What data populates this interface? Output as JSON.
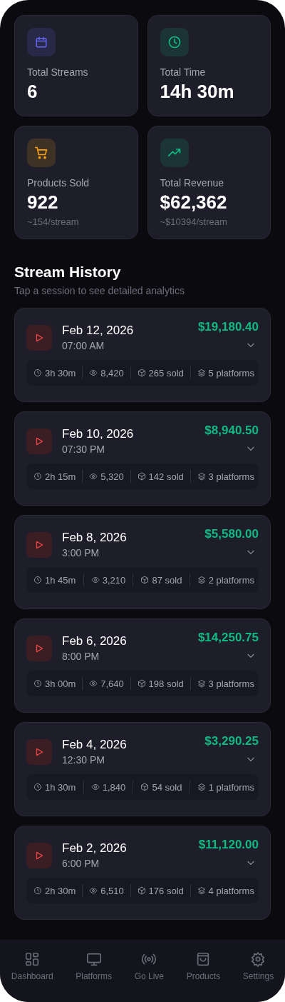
{
  "stats": [
    {
      "kind": "calendar",
      "color": "#6366f1",
      "label": "Total Streams",
      "value": "6"
    },
    {
      "kind": "clock",
      "color": "#10b981",
      "label": "Total Time",
      "value": "14h 30m"
    },
    {
      "kind": "cart",
      "color": "#f59e0b",
      "label": "Products Sold",
      "value": "922",
      "sub": "~154/stream"
    },
    {
      "kind": "trend",
      "color": "#10b981",
      "label": "Total Revenue",
      "value": "$62,362",
      "sub": "~$10394/stream"
    }
  ],
  "history": {
    "title": "Stream History",
    "subtitle": "Tap a session to see detailed analytics",
    "sessions": [
      {
        "date": "Feb 12, 2026",
        "time": "07:00 AM",
        "revenue": "$19,180.40",
        "expanded": false,
        "duration": "3h 30m",
        "views": "8,420",
        "sold": "265 sold",
        "platforms": "5 platforms"
      },
      {
        "date": "Feb 10, 2026",
        "time": "07:30 PM",
        "revenue": "$8,940.50",
        "expanded": false,
        "duration": "2h 15m",
        "views": "5,320",
        "sold": "142 sold",
        "platforms": "3 platforms"
      },
      {
        "date": "Feb 8, 2026",
        "time": "3:00 PM",
        "revenue": "$5,580.00",
        "expanded": false,
        "duration": "1h 45m",
        "views": "3,210",
        "sold": "87 sold",
        "platforms": "2 platforms"
      },
      {
        "date": "Feb 6, 2026",
        "time": "8:00 PM",
        "revenue": "$14,250.75",
        "expanded": false,
        "duration": "3h 00m",
        "views": "7,640",
        "sold": "198 sold",
        "platforms": "3 platforms"
      },
      {
        "date": "Feb 4, 2026",
        "time": "12:30 PM",
        "revenue": "$3,290.25",
        "expanded": false,
        "duration": "1h 30m",
        "views": "1,840",
        "sold": "54 sold",
        "platforms": "1 platforms"
      },
      {
        "date": "Feb 2, 2026",
        "time": "6:00 PM",
        "revenue": "$11,120.00",
        "expanded": false,
        "duration": "2h 30m",
        "views": "6,510",
        "sold": "176 sold",
        "platforms": "4 platforms"
      }
    ]
  },
  "nav": [
    {
      "kind": "grid",
      "label": "Dashboard",
      "selected": false
    },
    {
      "kind": "monitor",
      "label": "Platforms",
      "selected": false
    },
    {
      "kind": "broadcast",
      "label": "Go Live",
      "selected": false
    },
    {
      "kind": "bag",
      "label": "Products",
      "selected": false
    },
    {
      "kind": "gear",
      "label": "Settings",
      "selected": false
    }
  ]
}
